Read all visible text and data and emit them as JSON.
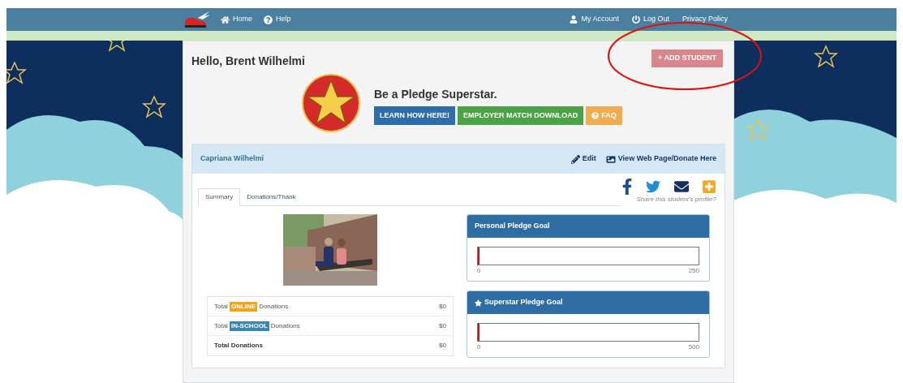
{
  "nav": {
    "left": [
      {
        "label": "Home"
      },
      {
        "label": "Help"
      }
    ],
    "right": [
      {
        "label": "My Account"
      },
      {
        "label": "Log Out"
      },
      {
        "label": "Privacy Policy"
      }
    ]
  },
  "greeting": "Hello, Brent Wilhelmi",
  "add_button": "+ ADD STUDENT",
  "promo": {
    "heading": "Be a Pledge Superstar.",
    "buttons": [
      {
        "label": "LEARN HOW HERE!",
        "kind": "info"
      },
      {
        "label": "EMPLOYER MATCH DOWNLOAD",
        "kind": "success"
      },
      {
        "label": "FAQ",
        "kind": "warning"
      }
    ]
  },
  "student": {
    "name": "Capriana Wilhelmi",
    "actions": [
      {
        "label": "Edit"
      },
      {
        "label": "View Web Page/Donate Here"
      }
    ],
    "tabs": [
      {
        "label": "Summary",
        "selected": true
      },
      {
        "label": "Donations/Thank",
        "selected": false
      }
    ],
    "share": {
      "caption": "Share this student's profile?"
    },
    "donations": [
      {
        "kind": "tagged",
        "prefix": "Total",
        "tag": "ONLINE",
        "color": "#f0a31c",
        "suffix": "Donations",
        "amount": "$0"
      },
      {
        "kind": "tagged",
        "prefix": "Total",
        "tag": "IN-SCHOOL",
        "color": "#3d86b0",
        "suffix": "Donations",
        "amount": "$0"
      },
      {
        "kind": "total",
        "label": "Total Donations",
        "amount": "$0"
      }
    ],
    "goals": [
      {
        "title": "Personal Pledge Goal",
        "starred": false,
        "level": 0,
        "min": "0",
        "max": "250"
      },
      {
        "title": "Superstar Pledge Goal",
        "starred": true,
        "level": 0,
        "min": "0",
        "max": "500"
      }
    ]
  }
}
